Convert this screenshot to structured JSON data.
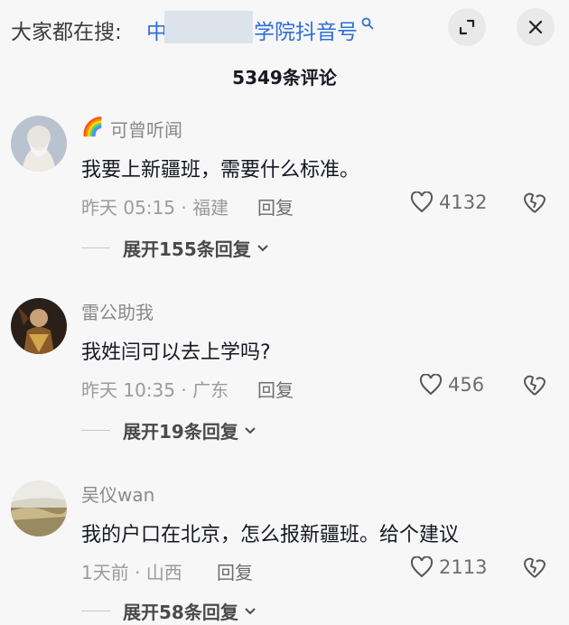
{
  "header": {
    "search_prefix": "大家都在搜:",
    "search_term_start": "中",
    "search_term_end": "学院抖音号",
    "search_icon": "search-icon",
    "expand_icon": "expand-icon",
    "close_icon": "close-icon"
  },
  "comment_count": "5349条评论",
  "comments": [
    {
      "username": "可曾听闻",
      "username_prefix_emoji": "🌈",
      "text": "我要上新疆班，需要什么标准。",
      "meta": "昨天 05:15 · 福建",
      "reply_label": "回复",
      "likes": "4132",
      "expand_label": "展开155条回复"
    },
    {
      "username": "雷公助我",
      "text": "我姓闫可以去上学吗?",
      "meta": "昨天 10:35 · 广东",
      "reply_label": "回复",
      "likes": "456",
      "expand_label": "展开19条回复"
    },
    {
      "username": "吴仪wan",
      "text": "我的户口在北京，怎么报新疆班。给个建议",
      "meta": "1天前 · 山西",
      "reply_label": "回复",
      "likes": "2113",
      "expand_label": "展开58条回复"
    }
  ],
  "colors": {
    "background": "#f7f7f7",
    "link_blue": "#2d6fd6",
    "text_primary": "#161823",
    "text_secondary": "#9b9b9b"
  }
}
